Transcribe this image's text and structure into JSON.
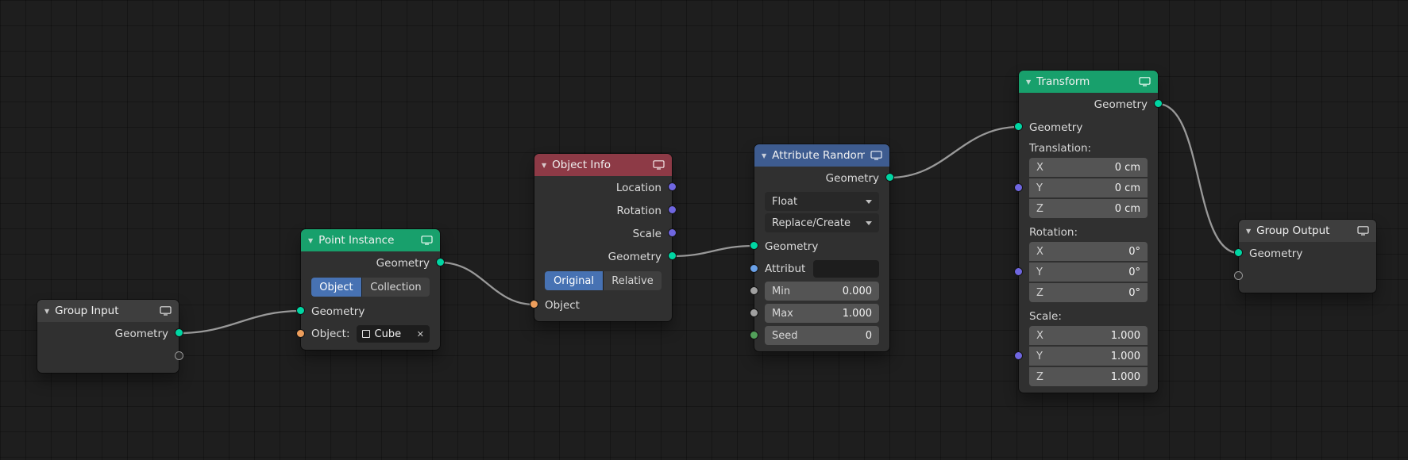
{
  "icons": {
    "collapse": "▼",
    "close": "✕"
  },
  "colors": {
    "accent_blue": "#4772B3",
    "header_gray": "#3E3E3E",
    "header_green": "#18A06C",
    "header_red": "#8D3A46",
    "header_blue": "#3E5C90",
    "socket_geometry": "#00D6A3",
    "socket_object": "#ED9E5C",
    "socket_vector": "#6F66E0",
    "socket_string": "#6AA1E8",
    "socket_float": "#A1A1A1",
    "socket_int": "#52A05A",
    "wire": "#999999"
  },
  "nodes": {
    "group_input": {
      "title": "Group Input",
      "output_geometry": "Geometry"
    },
    "point_instance": {
      "title": "Point Instance",
      "output_geometry": "Geometry",
      "btn_object": "Object",
      "btn_collection": "Collection",
      "input_geometry": "Geometry",
      "object_label": "Object:",
      "object_value": "Cube"
    },
    "object_info": {
      "title": "Object Info",
      "out_location": "Location",
      "out_rotation": "Rotation",
      "out_scale": "Scale",
      "out_geometry": "Geometry",
      "btn_original": "Original",
      "btn_relative": "Relative",
      "input_object": "Object"
    },
    "attribute_randomize": {
      "title": "Attribute Randomi..",
      "output_geometry": "Geometry",
      "dropdown_type": "Float",
      "dropdown_mode": "Replace/Create",
      "input_geometry": "Geometry",
      "attribute_label": "Attribut",
      "min_label": "Min",
      "min_value": "0.000",
      "max_label": "Max",
      "max_value": "1.000",
      "seed_label": "Seed",
      "seed_value": "0"
    },
    "transform": {
      "title": "Transform",
      "output_geometry": "Geometry",
      "input_geometry": "Geometry",
      "translation_label": "Translation:",
      "translation": [
        {
          "axis": "X",
          "value": "0 cm"
        },
        {
          "axis": "Y",
          "value": "0 cm"
        },
        {
          "axis": "Z",
          "value": "0 cm"
        }
      ],
      "rotation_label": "Rotation:",
      "rotation": [
        {
          "axis": "X",
          "value": "0°"
        },
        {
          "axis": "Y",
          "value": "0°"
        },
        {
          "axis": "Z",
          "value": "0°"
        }
      ],
      "scale_label": "Scale:",
      "scale": [
        {
          "axis": "X",
          "value": "1.000"
        },
        {
          "axis": "Y",
          "value": "1.000"
        },
        {
          "axis": "Z",
          "value": "1.000"
        }
      ]
    },
    "group_output": {
      "title": "Group Output",
      "input_geometry": "Geometry"
    }
  },
  "connections": [
    {
      "from": "group-input.geometry",
      "to": "point-instance.geometry"
    },
    {
      "from": "point-instance.geometry",
      "to": "object-info.object"
    },
    {
      "from": "object-info.geometry",
      "to": "attribute-randomize.geometry"
    },
    {
      "from": "attribute-randomize.geometry",
      "to": "transform.geometry"
    },
    {
      "from": "transform.geometry",
      "to": "group-output.geometry"
    }
  ]
}
